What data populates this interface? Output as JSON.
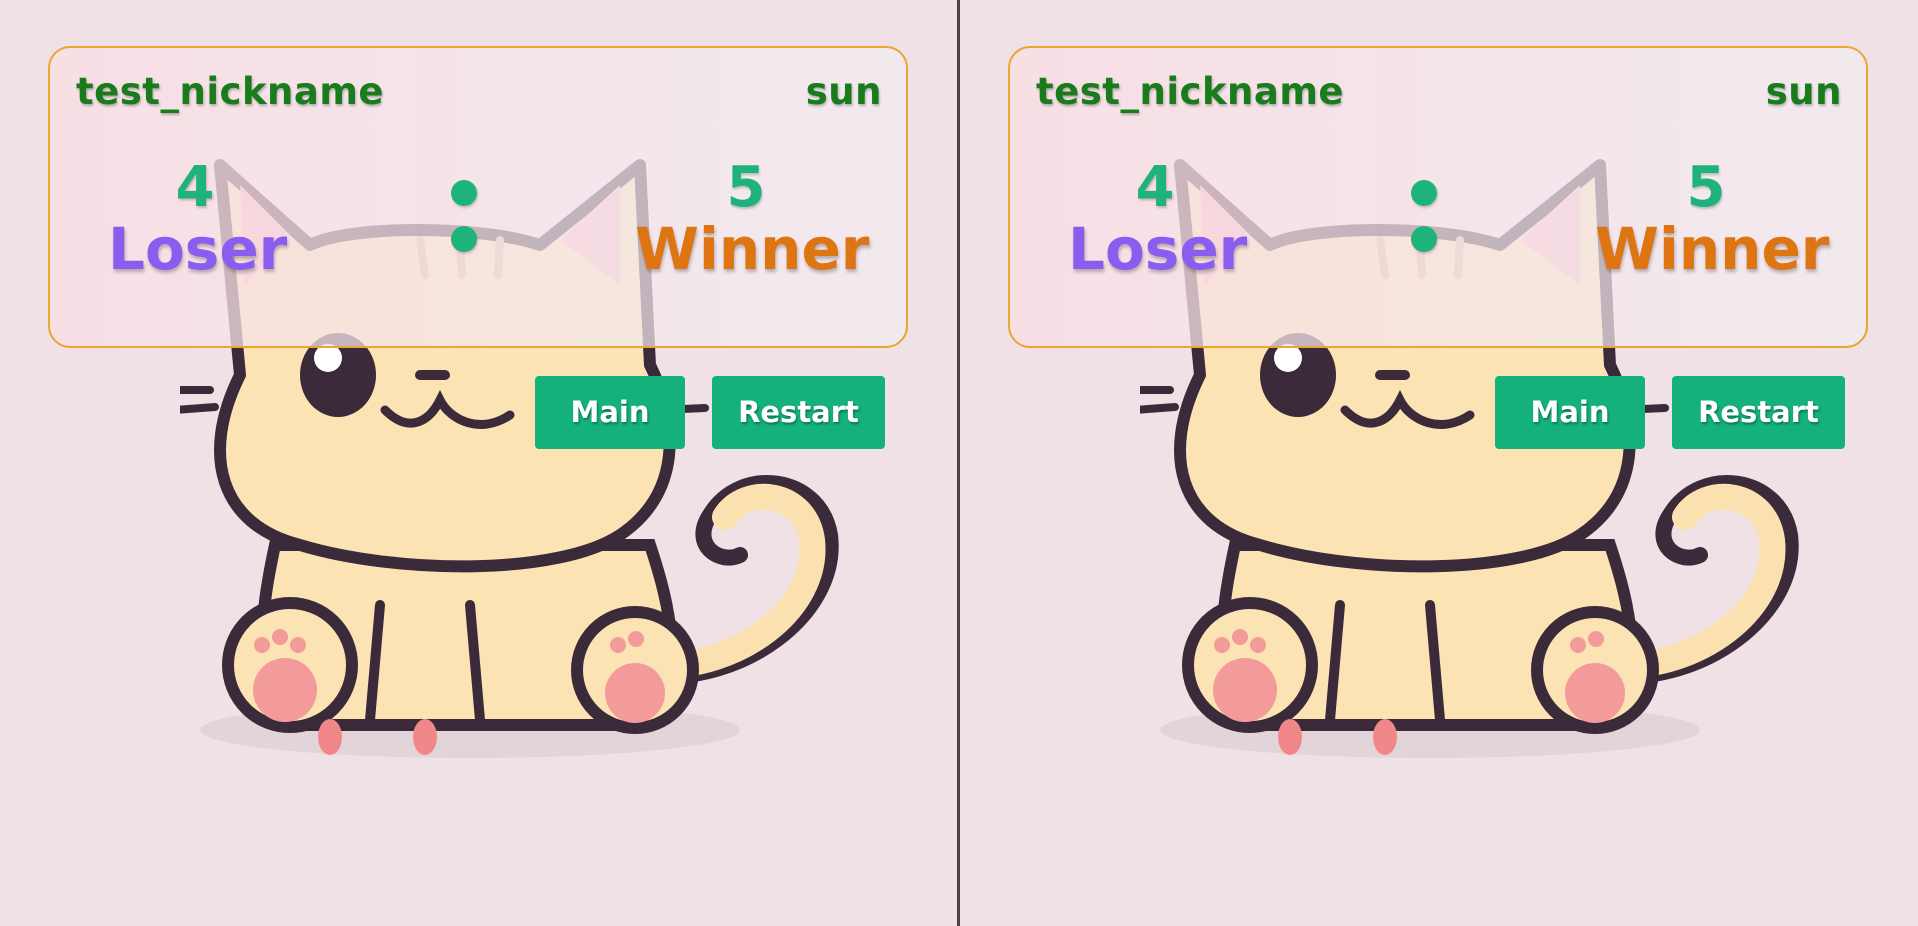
{
  "screens": [
    {
      "player1": {
        "name": "test_nickname",
        "score": "4",
        "result": "Loser"
      },
      "player2": {
        "name": "sun",
        "score": "5",
        "result": "Winner"
      },
      "buttons": {
        "main_label": "Main",
        "restart_label": "Restart"
      }
    },
    {
      "player1": {
        "name": "test_nickname",
        "score": "4",
        "result": "Loser"
      },
      "player2": {
        "name": "sun",
        "score": "5",
        "result": "Winner"
      },
      "buttons": {
        "main_label": "Main",
        "restart_label": "Restart"
      }
    }
  ],
  "colors": {
    "background": "#efe1e6",
    "panel_border": "#e9a630",
    "name": "#197c1c",
    "score": "#1fb37c",
    "loser": "#8a5df0",
    "winner": "#dc7512",
    "button": "#14b27a",
    "button_text": "#ffffff"
  },
  "icons": {
    "background_art": "cute-cat-illustration",
    "separator": "colon-icon"
  }
}
